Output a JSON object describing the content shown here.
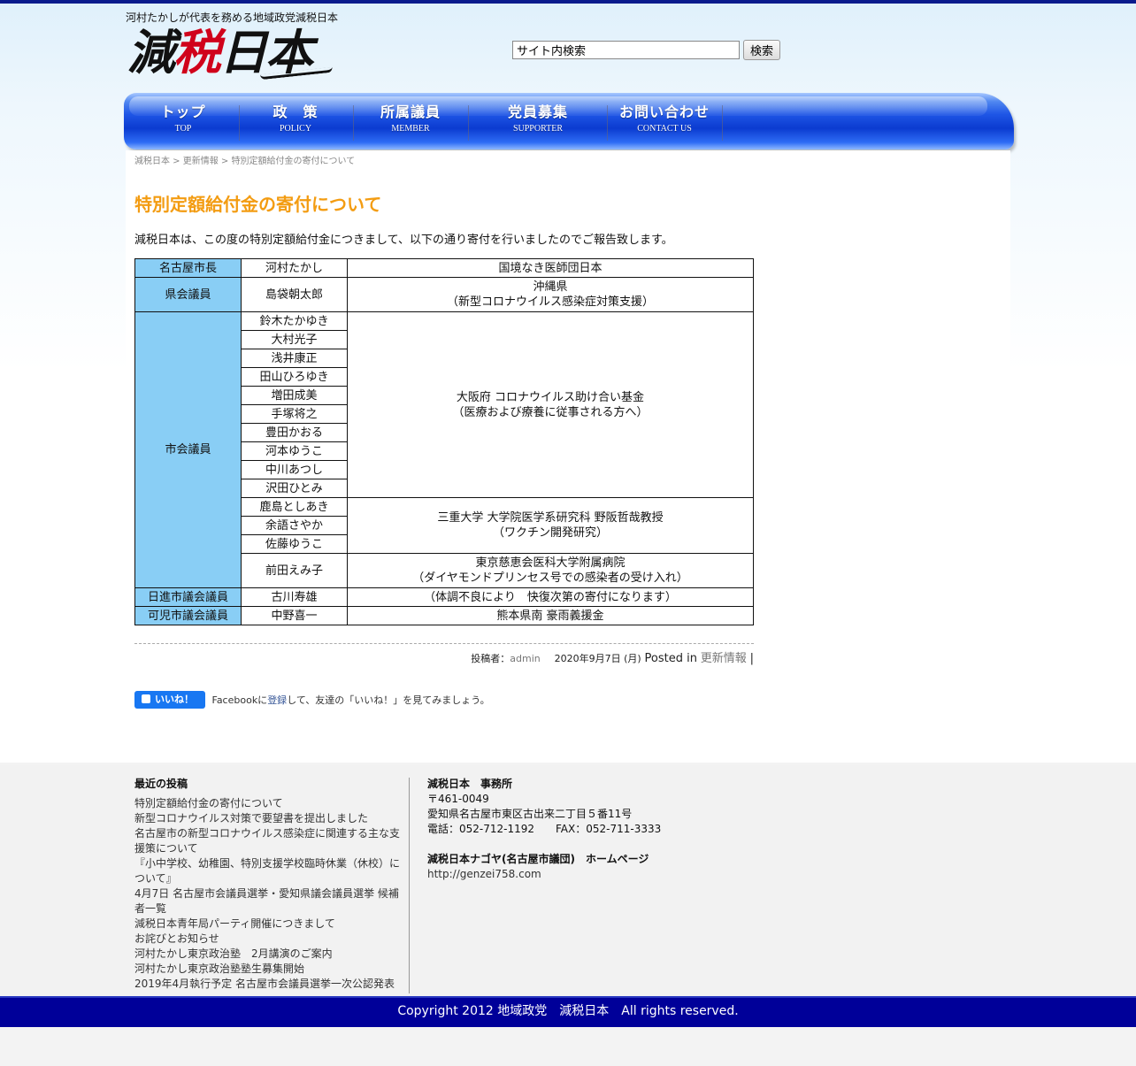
{
  "header": {
    "tagline": "河村たかしが代表を務める地域政党減税日本",
    "logo_chars": [
      "減",
      "税",
      "日本"
    ]
  },
  "search": {
    "value": "サイト内検索",
    "button": "検索"
  },
  "nav": [
    {
      "jp": "トップ",
      "en": "TOP"
    },
    {
      "jp": "政　策",
      "en": "POLICY"
    },
    {
      "jp": "所属議員",
      "en": "MEMBER"
    },
    {
      "jp": "党員募集",
      "en": "SUPPORTER"
    },
    {
      "jp": "お問い合わせ",
      "en": "CONTACT US"
    }
  ],
  "breadcrumb": {
    "home": "減税日本",
    "sep": " > ",
    "category": "更新情報",
    "current": "特別定額給付金の寄付について"
  },
  "post": {
    "title": "特別定額給付金の寄付について",
    "lead": "減税日本は、この度の特別定額給付金につきまして、以下の通り寄付を行いましたのでご報告致します。",
    "rows": {
      "mayor": {
        "role": "名古屋市長",
        "name": "河村たかし",
        "dest": "国境なき医師団日本"
      },
      "pref": {
        "role": "県会議員",
        "name": "島袋朝太郎",
        "dest1": "沖縄県",
        "dest2": "（新型コロナウイルス感染症対策支援）"
      },
      "city_role": "市会議員",
      "osaka_names": [
        "鈴木たかゆき",
        "大村光子",
        "浅井康正",
        "田山ひろゆき",
        "増田成美",
        "手塚将之",
        "豊田かおる",
        "河本ゆうこ",
        "中川あつし",
        "沢田ひとみ"
      ],
      "osaka_dest1": "大阪府 コロナウイルス助け合い基金",
      "osaka_dest2": "（医療および療養に従事される方へ）",
      "mie_names": [
        "鹿島としあき",
        "余語さやか",
        "佐藤ゆうこ"
      ],
      "mie_dest1": "三重大学 大学院医学系研究科 野阪哲哉教授",
      "mie_dest2": "（ワクチン開発研究）",
      "jikei": {
        "name": "前田えみ子",
        "dest1": "東京慈恵会医科大学附属病院",
        "dest2": "（ダイヤモンドプリンセス号での感染者の受け入れ）"
      },
      "nisshin": {
        "role": "日進市議会議員",
        "name": "古川寿雄",
        "dest": "（体調不良により　快復次第の寄付になります）"
      },
      "kani": {
        "role": "可児市議会議員",
        "name": "中野喜一",
        "dest": "熊本県南 豪雨義援金"
      }
    },
    "meta": {
      "by_label": "投稿者：",
      "author": "admin",
      "date": "2020年9月7日 (月)",
      "posted_in": "Posted in",
      "category": "更新情報",
      "trail": "|"
    }
  },
  "facebook": {
    "like": "いいね！",
    "pre": "Facebookに",
    "link": "登録",
    "post": "して、友達の「いいね！」を見てみましょう。"
  },
  "footer": {
    "recent_title": "最近の投稿",
    "recent": [
      "特別定額給付金の寄付について",
      "新型コロナウイルス対策で要望書を提出しました",
      "名古屋市の新型コロナウイルス感染症に関連する主な支援策について",
      "『小中学校、幼稚園、特別支援学校臨時休業（休校）について』",
      "4月7日 名古屋市会議員選挙・愛知県議会議員選挙 候補者一覧",
      "減税日本青年局パーティ開催につきまして",
      "お詫びとお知らせ",
      "河村たかし東京政治塾　2月講演のご案内",
      "河村たかし東京政治塾塾生募集開始",
      "2019年4月執行予定 名古屋市会議員選挙一次公認発表"
    ],
    "office_title": "減税日本　事務所",
    "postal": "〒461-0049",
    "address": "愛知県名古屋市東区古出来二丁目５番11号",
    "phone": "電話：052-712-1192　　FAX：052-711-3333",
    "nagoya_title": "減税日本ナゴヤ(名古屋市議団)　ホームページ",
    "nagoya_url": "http://genzei758.com"
  },
  "copyright": "Copyright 2012 地域政党　減税日本　All rights reserved."
}
